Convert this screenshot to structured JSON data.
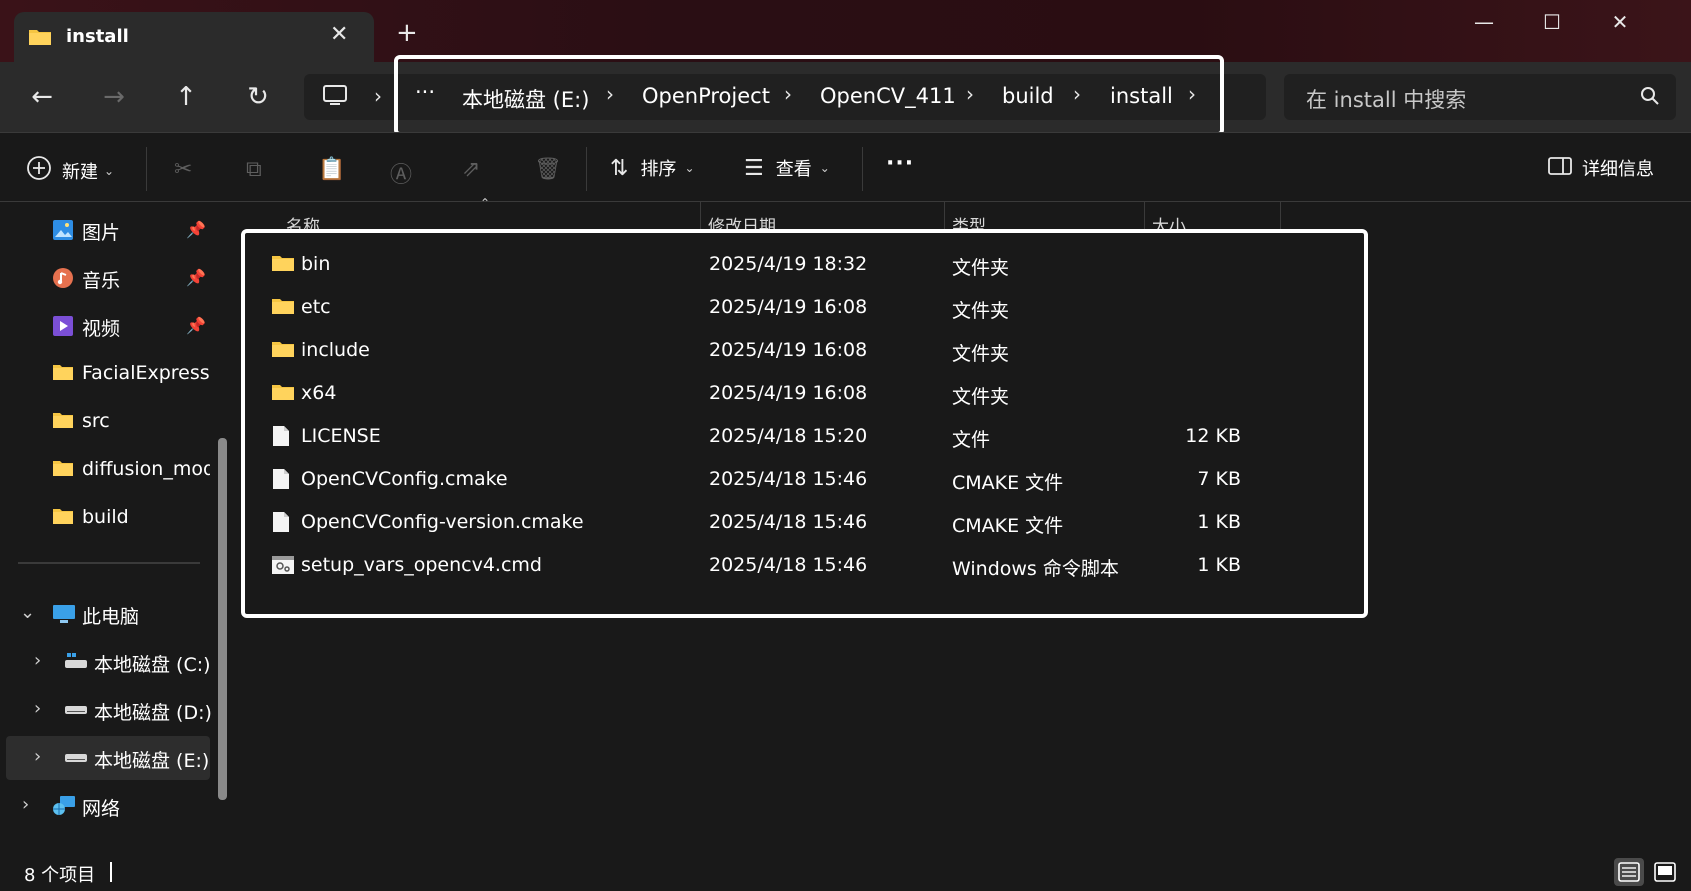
{
  "window": {
    "tab_title": "install",
    "tab_close": "✕",
    "new_tab": "+",
    "minimize": "—",
    "maximize": "☐",
    "close": "✕"
  },
  "nav": {
    "back": "←",
    "forward": "→",
    "up": "↑",
    "refresh": "↻",
    "more_crumbs": "···",
    "separator": "›"
  },
  "breadcrumbs": [
    "本地磁盘 (E:)",
    "OpenProject",
    "OpenCV_411",
    "build",
    "install"
  ],
  "search": {
    "placeholder": "在 install 中搜索"
  },
  "toolbar": {
    "new_label": "新建",
    "sort_label": "排序",
    "view_label": "查看",
    "more": "···",
    "details_label": "详细信息"
  },
  "sidebar": {
    "quick_access": [
      {
        "label": "图片",
        "icon": "pictures-icon",
        "pinned": true
      },
      {
        "label": "音乐",
        "icon": "music-icon",
        "pinned": true
      },
      {
        "label": "视频",
        "icon": "videos-icon",
        "pinned": true
      },
      {
        "label": "FacialExpressio",
        "icon": "folder-icon",
        "pinned": false
      },
      {
        "label": "src",
        "icon": "folder-icon",
        "pinned": false
      },
      {
        "label": "diffusion_mode",
        "icon": "folder-icon",
        "pinned": false
      },
      {
        "label": "build",
        "icon": "folder-icon",
        "pinned": false
      }
    ],
    "this_pc": "此电脑",
    "drives": [
      "本地磁盘 (C:)",
      "本地磁盘 (D:)",
      "本地磁盘 (E:)"
    ],
    "selected_drive": "本地磁盘 (E:)",
    "network": "网络"
  },
  "columns": {
    "name": "名称",
    "modified": "修改日期",
    "type": "类型",
    "size": "大小"
  },
  "files": [
    {
      "name": "bin",
      "modified": "2025/4/19 18:32",
      "type": "文件夹",
      "size": "",
      "icon": "folder-icon"
    },
    {
      "name": "etc",
      "modified": "2025/4/19 16:08",
      "type": "文件夹",
      "size": "",
      "icon": "folder-icon"
    },
    {
      "name": "include",
      "modified": "2025/4/19 16:08",
      "type": "文件夹",
      "size": "",
      "icon": "folder-icon"
    },
    {
      "name": "x64",
      "modified": "2025/4/19 16:08",
      "type": "文件夹",
      "size": "",
      "icon": "folder-icon"
    },
    {
      "name": "LICENSE",
      "modified": "2025/4/18 15:20",
      "type": "文件",
      "size": "12 KB",
      "icon": "file-icon"
    },
    {
      "name": "OpenCVConfig.cmake",
      "modified": "2025/4/18 15:46",
      "type": "CMAKE 文件",
      "size": "7 KB",
      "icon": "file-icon"
    },
    {
      "name": "OpenCVConfig-version.cmake",
      "modified": "2025/4/18 15:46",
      "type": "CMAKE 文件",
      "size": "1 KB",
      "icon": "file-icon"
    },
    {
      "name": "setup_vars_opencv4.cmd",
      "modified": "2025/4/18 15:46",
      "type": "Windows 命令脚本",
      "size": "1 KB",
      "icon": "script-icon"
    }
  ],
  "status": {
    "item_count": "8 个项目"
  },
  "colors": {
    "folder": "#f5c542",
    "highlight_box": "#ffffff",
    "background": "#191919"
  }
}
